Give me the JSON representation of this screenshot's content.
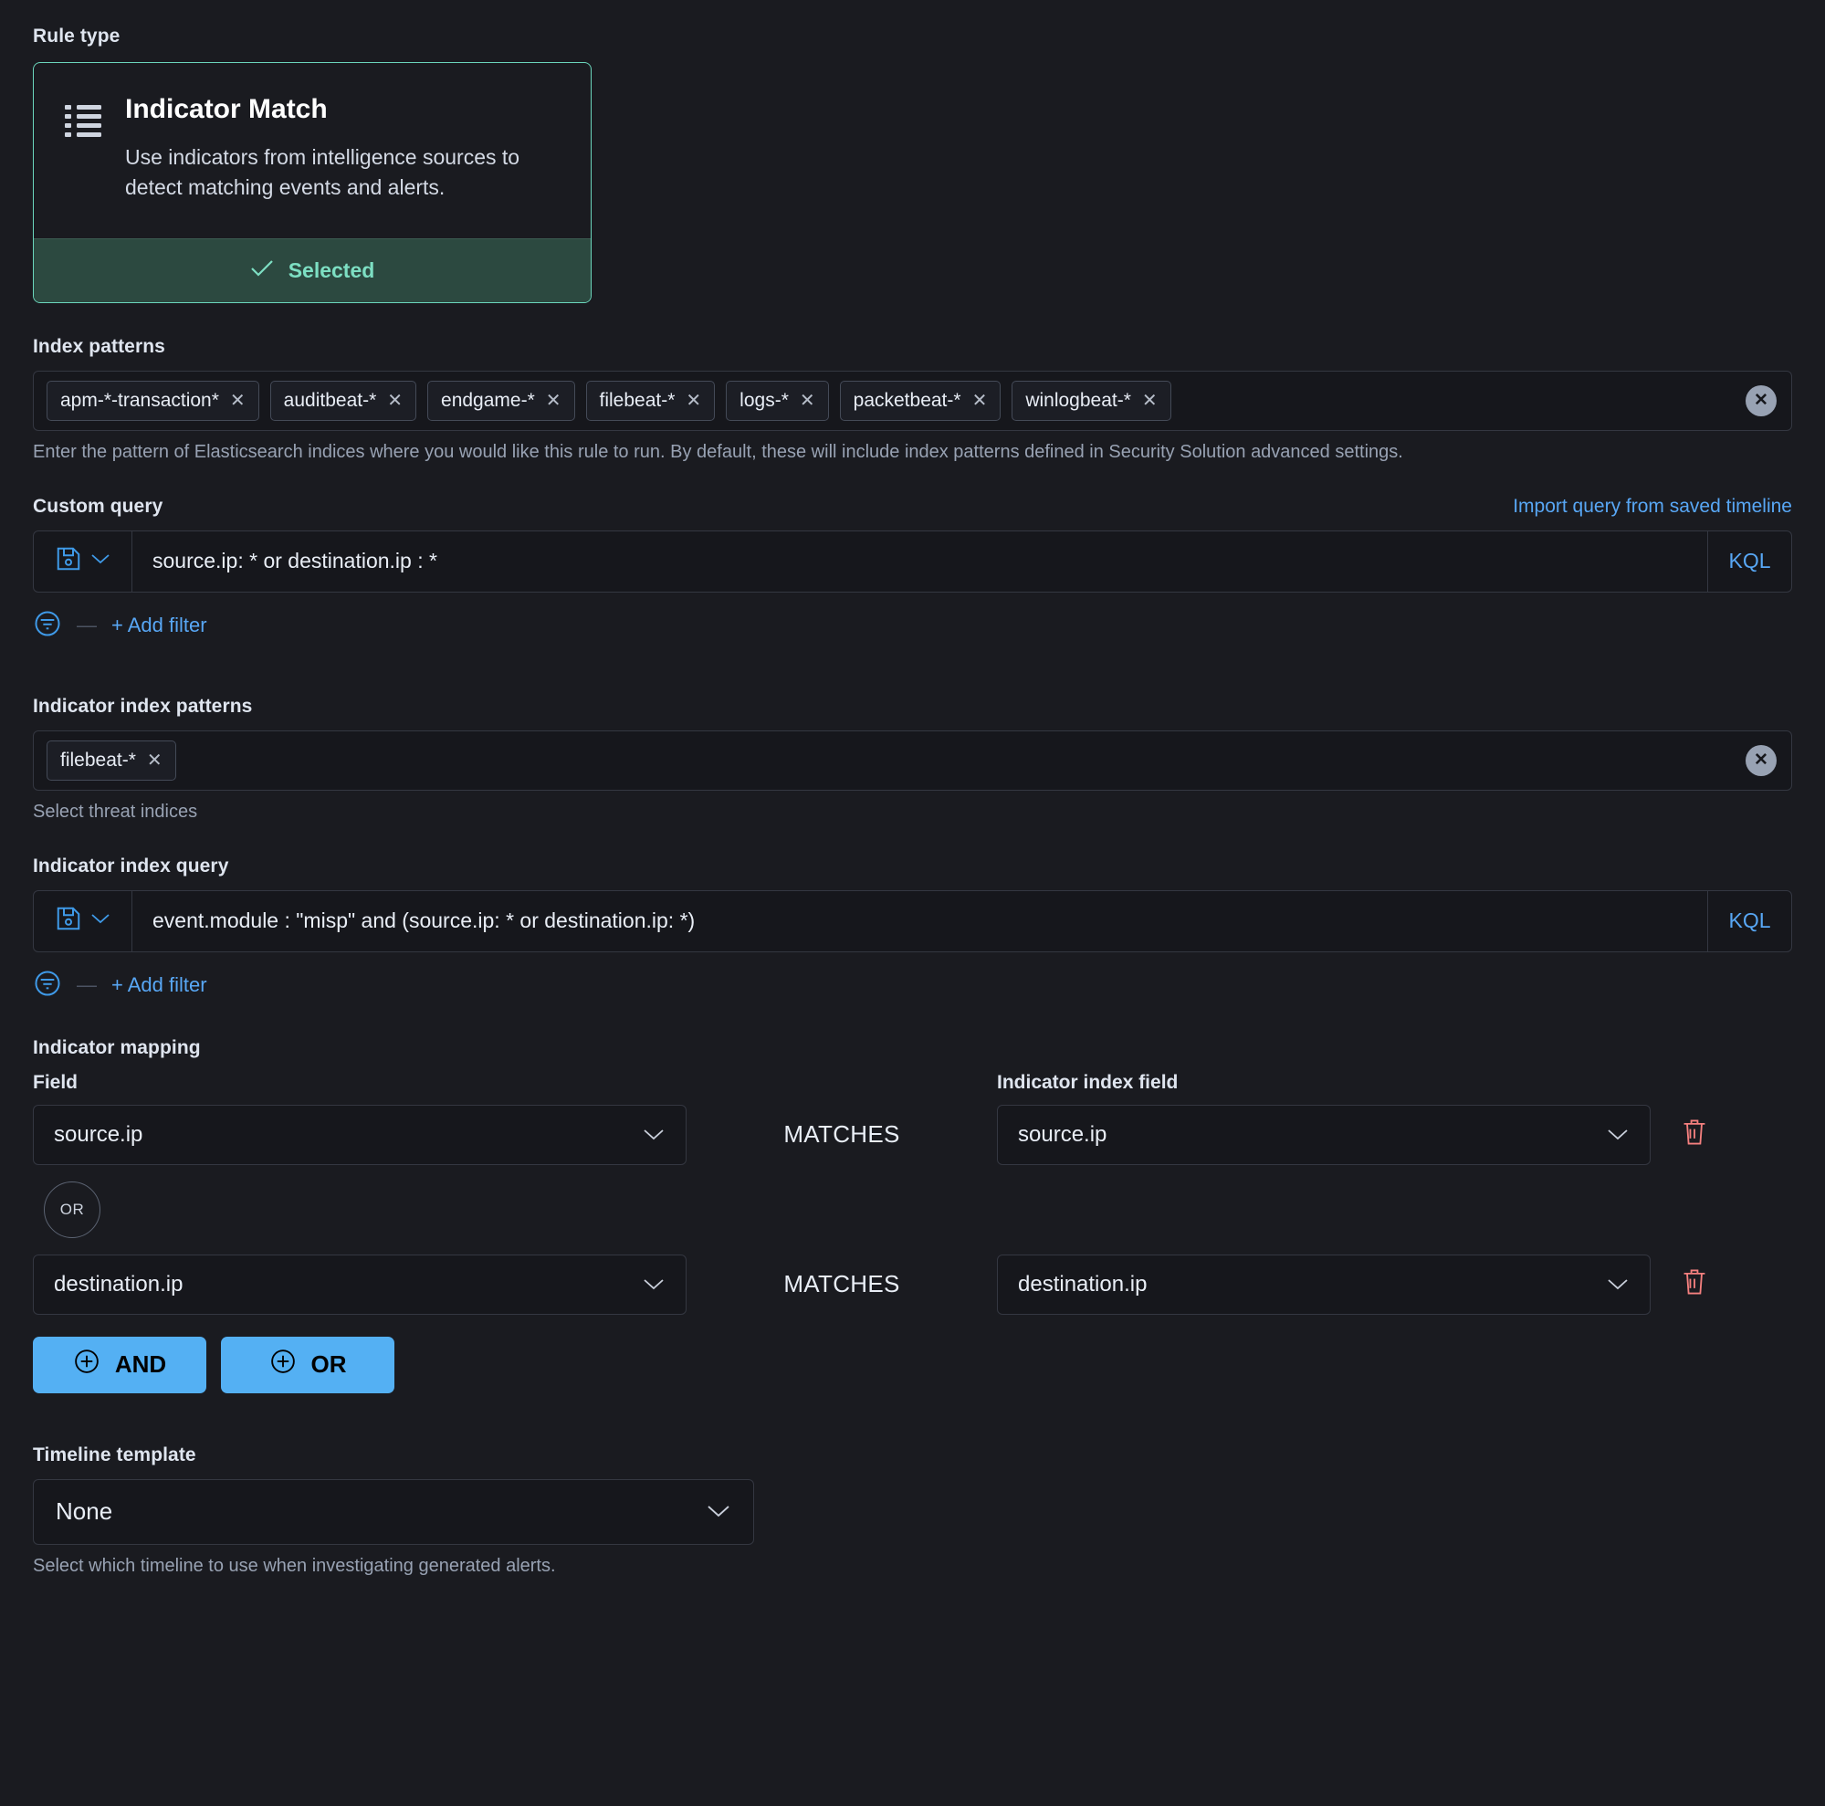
{
  "rule_type": {
    "label": "Rule type",
    "card": {
      "icon": "list-icon",
      "title": "Indicator Match",
      "description": "Use indicators from intelligence sources to detect matching events and alerts.",
      "selected_label": "Selected",
      "accent_color": "#6bd6bc",
      "footer_bg": "#2c4940"
    }
  },
  "index_patterns": {
    "label": "Index patterns",
    "pills": [
      "apm-*-transaction*",
      "auditbeat-*",
      "endgame-*",
      "filebeat-*",
      "logs-*",
      "packetbeat-*",
      "winlogbeat-*"
    ],
    "clear_icon": "clear-all-icon",
    "help": "Enter the pattern of Elasticsearch indices where you would like this rule to run. By default, these will include index patterns defined in Security Solution advanced settings."
  },
  "custom_query": {
    "label": "Custom query",
    "import_link": "Import query from saved timeline",
    "saved_query_icon": "save-icon",
    "chevron_icon": "chevron-down-icon",
    "value": "source.ip: * or destination.ip : *",
    "language": "KQL",
    "filter_icon": "filter-icon",
    "add_filter_label": "+ Add filter"
  },
  "indicator_index_patterns": {
    "label": "Indicator index patterns",
    "pills": [
      "filebeat-*"
    ],
    "clear_icon": "clear-all-icon",
    "help": "Select threat indices"
  },
  "indicator_index_query": {
    "label": "Indicator index query",
    "saved_query_icon": "save-icon",
    "chevron_icon": "chevron-down-icon",
    "value": "event.module : \"misp\" and (source.ip: *  or destination.ip: *)",
    "language": "KQL",
    "filter_icon": "filter-icon",
    "add_filter_label": "+ Add filter"
  },
  "indicator_mapping": {
    "label": "Indicator mapping",
    "field_col_label": "Field",
    "indicator_field_col_label": "Indicator index field",
    "operator_label": "MATCHES",
    "or_badge": "OR",
    "rows": [
      {
        "field": "source.ip",
        "operator": "MATCHES",
        "indicator_field": "source.ip",
        "delete_icon": "trash-icon"
      },
      {
        "field": "destination.ip",
        "operator": "MATCHES",
        "indicator_field": "destination.ip",
        "delete_icon": "trash-icon"
      }
    ],
    "buttons": [
      {
        "label": "AND",
        "icon": "plus-circle-icon"
      },
      {
        "label": "OR",
        "icon": "plus-circle-icon"
      }
    ],
    "button_color": "#54b0f3"
  },
  "timeline_template": {
    "label": "Timeline template",
    "value": "None",
    "chevron_icon": "chevron-down-icon",
    "help": "Select which timeline to use when investigating generated alerts."
  }
}
